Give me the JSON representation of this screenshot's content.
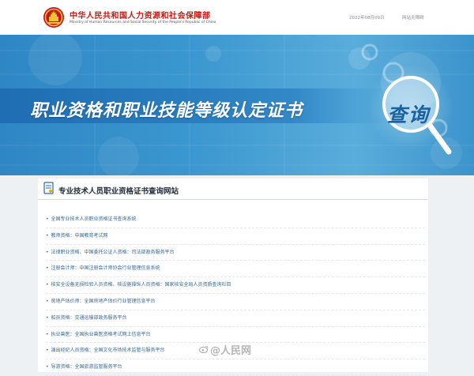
{
  "header": {
    "org_name_cn": "中华人民共和国人力资源和社会保障部",
    "org_name_en": "Ministry of Human Resources and Social Security of the People's Republic of China",
    "date": "2022年08月09日",
    "barrier_free": "网站无障碍"
  },
  "banner": {
    "title": "职业资格和职业技能等级认定证书",
    "query": "查询"
  },
  "section": {
    "title": "专业技术人员职业资格证书查询网站"
  },
  "links": [
    "全国专业技术人员职业资格证书查询系统",
    "教师资格：中国教育考试网",
    "法律职业资格、中国委托公证人资格：司法部政务服务平台",
    "注册会计师：中国注册会计师协会行业管理信息系统",
    "核安全设备无损检验人员资格、核设施操纵人员资格：国家核安全局人员资质查询栏目",
    "房地产估价师：全国房地产估价行业管理信息平台",
    "船员资格：交通运输部政务服务平台",
    "执业兽医：全国执业兽医资格考试网上信息平台",
    "演出经纪人员资格：全国文化市场技术监管与服务平台",
    "导游资格：全国旅游监管服务平台"
  ],
  "watermark": "@人民网",
  "colors": {
    "brand_red": "#c41a16",
    "banner_blue": "#3b97cf",
    "link_blue": "#2c6aa8",
    "query_blue": "#1b62a0"
  },
  "icons": {
    "emblem": "national-emblem-icon",
    "section": "certificate-icon",
    "watermark": "weibo-icon"
  }
}
